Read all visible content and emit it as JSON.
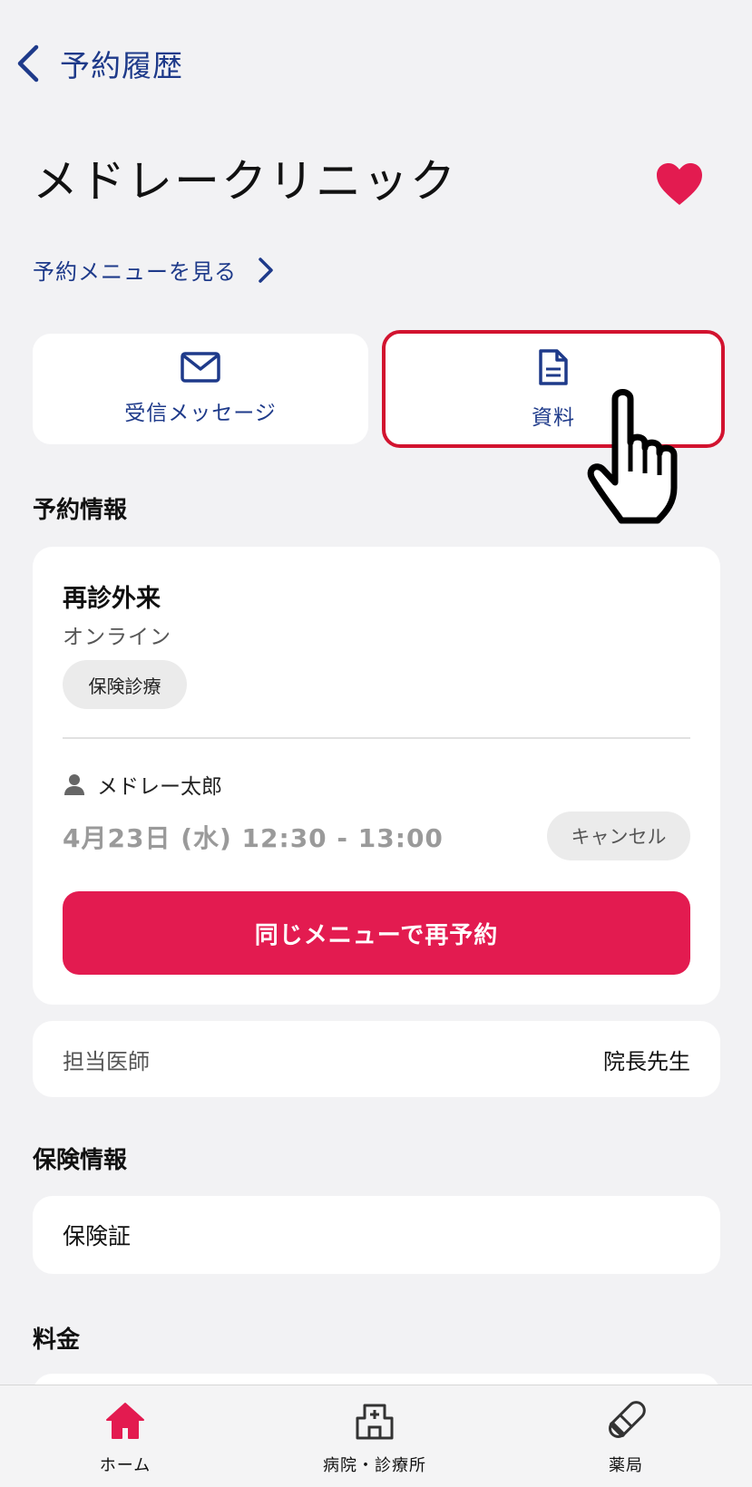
{
  "header": {
    "back_label": "予約履歴"
  },
  "clinic": {
    "name": "メドレークリニック"
  },
  "menu_link": {
    "label": "予約メニューを見る"
  },
  "actions": {
    "messages_label": "受信メッセージ",
    "documents_label": "資料"
  },
  "reservation": {
    "section_title": "予約情報",
    "visit_name": "再診外来",
    "visit_type": "オンライン",
    "tag": "保険診療",
    "patient_name": "メドレー太郎",
    "datetime": "4月23日 (水) 12:30 - 13:00",
    "cancel_label": "キャンセル",
    "rebook_label": "同じメニューで再予約"
  },
  "doctor": {
    "label": "担当医師",
    "value": "院長先生"
  },
  "insurance": {
    "section_title": "保険情報",
    "item_label": "保険証"
  },
  "fee": {
    "section_title": "料金"
  },
  "tabs": [
    {
      "label": "ホーム",
      "icon": "home-icon",
      "active": true
    },
    {
      "label": "病院・診療所",
      "icon": "hospital-icon",
      "active": false
    },
    {
      "label": "薬局",
      "icon": "pill-icon",
      "active": false
    }
  ],
  "colors": {
    "accent_blue": "#1e3a8a",
    "brand_red": "#e31b50",
    "highlight_red": "#d2132f"
  }
}
